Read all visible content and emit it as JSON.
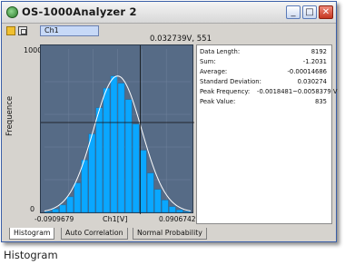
{
  "window": {
    "title": "OS-1000Analyzer 2",
    "buttons": {
      "minimize": "_",
      "maximize": "□",
      "close": "✕"
    }
  },
  "toolbar": {
    "channel_tab": "Ch1"
  },
  "cursor_readout": "0.032739V, 551",
  "chart_data": {
    "type": "bar",
    "ylabel": "Frequence",
    "xlabel": "Ch1[V]",
    "x_min_label": "-0.0909679",
    "x_max_label": "0.0906742",
    "ylim": [
      0,
      1000
    ],
    "y_max_label": "1000",
    "y_min_label": "0",
    "bin_values": [
      5,
      20,
      45,
      95,
      180,
      320,
      480,
      640,
      760,
      835,
      790,
      690,
      540,
      380,
      240,
      140,
      75,
      35,
      15,
      5
    ],
    "fit_curve": "normal",
    "colors": {
      "bars": "#0aa7ff",
      "background": "#566b86",
      "curve": "#ffffff"
    }
  },
  "stats": [
    {
      "label": "Data Length:",
      "value": "8192"
    },
    {
      "label": "Sum:",
      "value": "-1.2031"
    },
    {
      "label": "Average:",
      "value": "-0.00014686"
    },
    {
      "label": "Standard Deviation:",
      "value": "0.030274"
    },
    {
      "label": "Peak Frequency:",
      "value": "-0.0018481~0.0058379 V"
    },
    {
      "label": "Peak Value:",
      "value": "835"
    }
  ],
  "tabs": [
    "Histogram",
    "Auto Correlation",
    "Normal Probability"
  ],
  "caption": "Histogram"
}
